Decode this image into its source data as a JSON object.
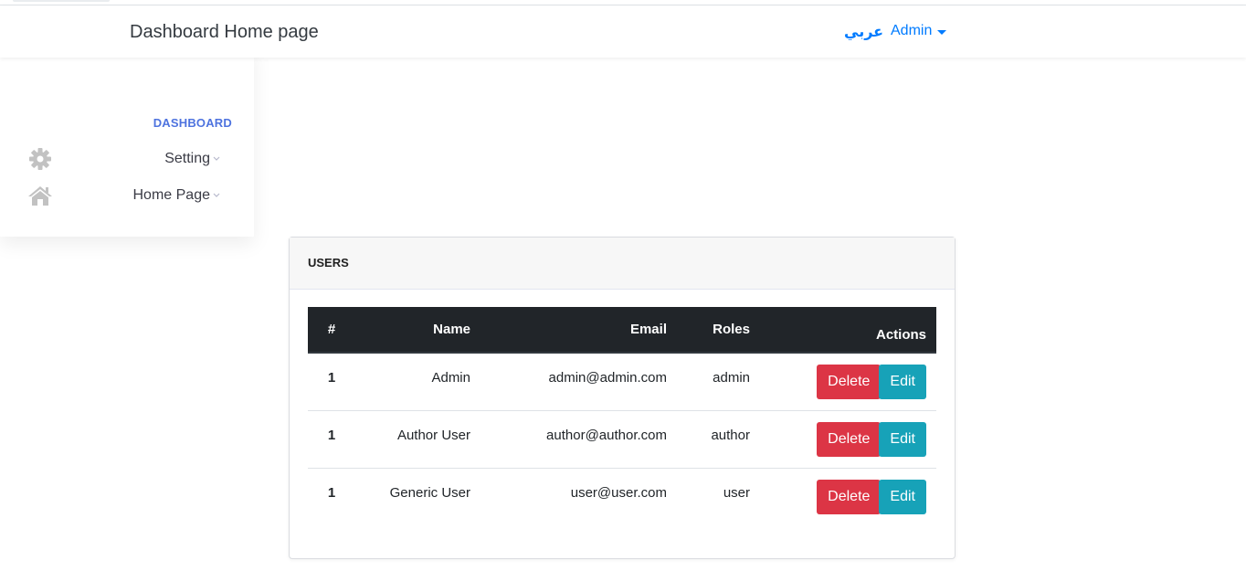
{
  "navbar": {
    "title": "Dashboard Home page",
    "language_link": "عربي",
    "user_menu": "Admin"
  },
  "sidebar": {
    "heading": "DASHBOARD",
    "items": [
      {
        "label": "Setting",
        "icon": "gear-icon"
      },
      {
        "label": "Home Page",
        "icon": "home-icon"
      }
    ]
  },
  "users_card": {
    "header": "USERS",
    "columns": [
      "#",
      "Name",
      "Email",
      "Roles",
      "Actions"
    ],
    "rows": [
      {
        "id": "1",
        "name": "Admin",
        "email": "admin@admin.com",
        "role": "admin"
      },
      {
        "id": "1",
        "name": "Author User",
        "email": "author@author.com",
        "role": "author"
      },
      {
        "id": "1",
        "name": "Generic User",
        "email": "user@user.com",
        "role": "user"
      }
    ],
    "delete_label": "Delete",
    "edit_label": "Edit"
  },
  "colors": {
    "primary": "#007bff",
    "sidebar_heading": "#4e73df",
    "danger": "#dc3545",
    "info": "#17a2b8",
    "table_head": "#212529"
  }
}
